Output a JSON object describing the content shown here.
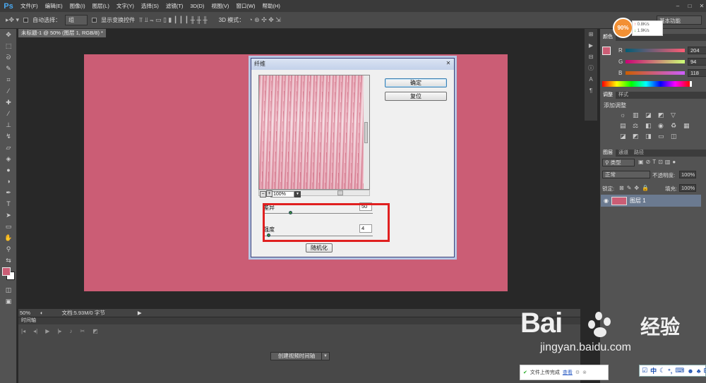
{
  "app": {
    "logo": "Ps"
  },
  "menu": [
    "文件(F)",
    "编辑(E)",
    "图像(I)",
    "图层(L)",
    "文字(Y)",
    "选择(S)",
    "滤镜(T)",
    "3D(D)",
    "视图(V)",
    "窗口(W)",
    "帮助(H)"
  ],
  "options": {
    "auto_select_label": "自动选择：",
    "auto_select_value": "组",
    "show_transform_label": "显示变换控件",
    "mode3d_label": "3D 模式：",
    "workspace": "基本功能"
  },
  "document": {
    "tab_title": "未标题-1 @ 50% (图层 1, RGB/8) *",
    "zoom": "50%",
    "doc_info": "文档:5.93M/0 字节"
  },
  "timeline": {
    "tab": "时间轴",
    "create_button": "创建视频时间轴"
  },
  "color_panel": {
    "tab": "颜色",
    "r_label": "R",
    "g_label": "G",
    "b_label": "B",
    "r": "204",
    "g": "94",
    "b": "118",
    "fg_color": "#cb5d75"
  },
  "adjust_panel": {
    "tab_adjust": "调整",
    "tab_style": "样式",
    "add_label": "添加调整"
  },
  "layers_panel": {
    "tab_layers": "图层",
    "tab_channels": "通道",
    "tab_paths": "路径",
    "filter_kind": "类型",
    "blend_mode": "正常",
    "opacity_label": "不透明度:",
    "opacity": "100%",
    "lock_label": "锁定:",
    "fill_label": "填充:",
    "fill": "100%",
    "layer_name": "图层 1"
  },
  "dialog": {
    "title": "纤维",
    "ok": "确定",
    "reset": "复位",
    "zoom": "100%",
    "variance_label": "差异",
    "variance_value": "50",
    "strength_label": "强度",
    "strength_value": "4",
    "randomize": "随机化"
  },
  "network": {
    "percent": "90%",
    "up": "0.8K/s",
    "down": "1.9K/s"
  },
  "watermark": {
    "brand": "Bai",
    "brand_cn": "经验",
    "url": "jingyan.baidu.com"
  },
  "toast": {
    "text": "文件上传完成",
    "link": "查看"
  },
  "ime": {
    "lang": "中"
  }
}
